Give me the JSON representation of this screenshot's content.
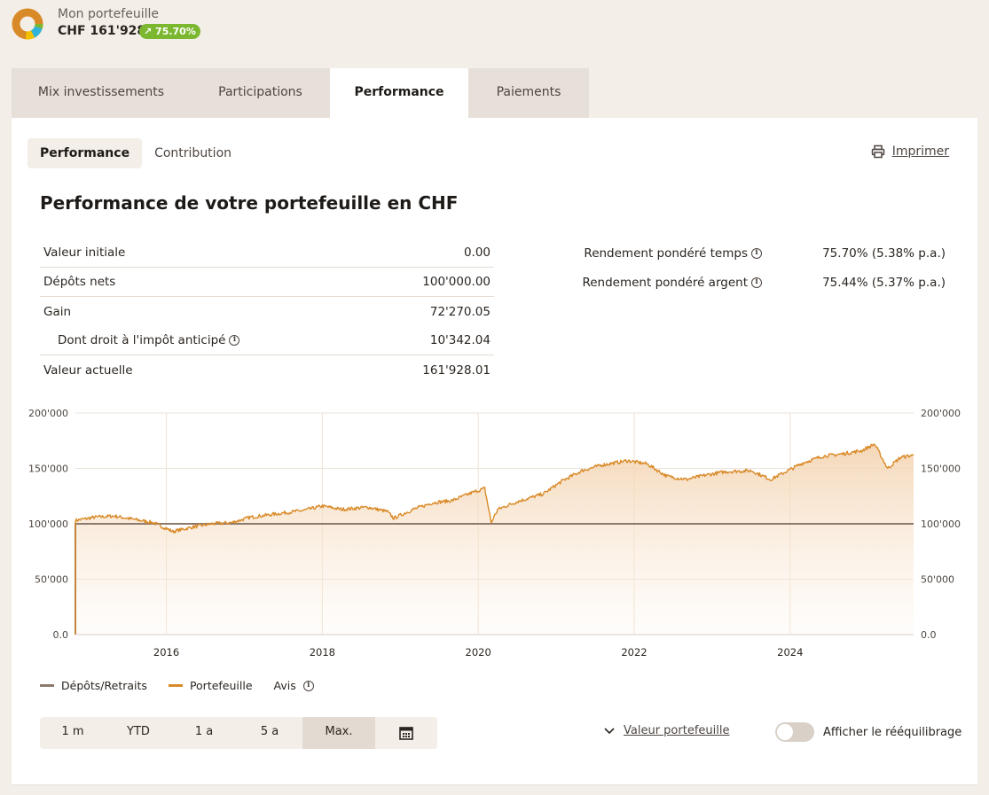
{
  "header": {
    "title": "Mon portefeuille",
    "value": "CHF 161'928",
    "badge": "↗ 75.70%",
    "badge_color": "#7cb82f",
    "donut_colors": [
      "#d98a28",
      "#f2c200",
      "#2fb5d9",
      "#7cb82f"
    ]
  },
  "tabs": [
    {
      "label": "Mix investissements"
    },
    {
      "label": "Participations"
    },
    {
      "label": "Performance"
    },
    {
      "label": "Paiements"
    }
  ],
  "active_tab": "Performance",
  "subtabs": [
    {
      "label": "Performance"
    },
    {
      "label": "Contribution"
    }
  ],
  "print_label": "Imprimer",
  "heading": "Performance de votre portefeuille en CHF",
  "stats": [
    {
      "label": "Valeur initiale",
      "value": "0.00"
    },
    {
      "label": "Dépôts nets",
      "value": "100'000.00"
    },
    {
      "label": "Gain",
      "value": "72'270.05"
    },
    {
      "label": "Dont droit à l'impôt anticipé",
      "value": "10'342.04"
    },
    {
      "label": "Valeur actuelle",
      "value": "161'928.01"
    }
  ],
  "returns": [
    {
      "label": "Rendement pondéré temps",
      "value": "75.70% (5.38% p.a.)"
    },
    {
      "label": "Rendement pondéré argent",
      "value": "75.44% (5.37% p.a.)"
    }
  ],
  "chart_data": {
    "type": "line",
    "x_tick_labels": [
      "2016",
      "2018",
      "2020",
      "2022",
      "2024"
    ],
    "y_tick_labels": [
      "0.0",
      "50'000",
      "100'000",
      "150'000",
      "200'000"
    ],
    "ylim": [
      0,
      200000
    ],
    "xlim": [
      "2014-11",
      "2025-08"
    ],
    "grid": true,
    "colors": {
      "deposits": "#8c7a6e",
      "portfolio": "#d98a28"
    },
    "series": [
      {
        "name": "Dépôts/Retraits",
        "points": [
          [
            "2014-11",
            0
          ],
          [
            "2014-11",
            100000
          ],
          [
            "2025-08",
            100000
          ]
        ]
      },
      {
        "name": "Portefeuille",
        "points": [
          [
            "2014-11",
            0
          ],
          [
            "2014-11",
            103000
          ],
          [
            "2015-02",
            106000
          ],
          [
            "2015-05",
            107000
          ],
          [
            "2015-08",
            104000
          ],
          [
            "2015-11",
            101000
          ],
          [
            "2016-02",
            93000
          ],
          [
            "2016-05",
            97000
          ],
          [
            "2016-08",
            100000
          ],
          [
            "2016-11",
            101000
          ],
          [
            "2017-02",
            106000
          ],
          [
            "2017-06",
            109000
          ],
          [
            "2017-10",
            112000
          ],
          [
            "2018-01",
            116000
          ],
          [
            "2018-04",
            113000
          ],
          [
            "2018-08",
            115000
          ],
          [
            "2018-11",
            111000
          ],
          [
            "2018-12",
            105000
          ],
          [
            "2019-03",
            113000
          ],
          [
            "2019-06",
            119000
          ],
          [
            "2019-09",
            121000
          ],
          [
            "2019-12",
            128000
          ],
          [
            "2020-02",
            132000
          ],
          [
            "2020-03",
            101000
          ],
          [
            "2020-04",
            113000
          ],
          [
            "2020-07",
            120000
          ],
          [
            "2020-11",
            127000
          ],
          [
            "2021-02",
            139000
          ],
          [
            "2021-05",
            148000
          ],
          [
            "2021-08",
            153000
          ],
          [
            "2021-12",
            157000
          ],
          [
            "2022-03",
            154000
          ],
          [
            "2022-06",
            143000
          ],
          [
            "2022-09",
            140000
          ],
          [
            "2022-12",
            144000
          ],
          [
            "2023-03",
            147000
          ],
          [
            "2023-07",
            148000
          ],
          [
            "2023-10",
            140000
          ],
          [
            "2023-12",
            146000
          ],
          [
            "2024-03",
            155000
          ],
          [
            "2024-06",
            161000
          ],
          [
            "2024-09",
            163000
          ],
          [
            "2024-12",
            166000
          ],
          [
            "2025-02",
            172000
          ],
          [
            "2025-04",
            150000
          ],
          [
            "2025-06",
            160000
          ],
          [
            "2025-08",
            161928
          ]
        ]
      }
    ],
    "legend": {
      "notice_label": "Avis"
    }
  },
  "ranges": [
    {
      "label": "1 m"
    },
    {
      "label": "YTD"
    },
    {
      "label": "1 a"
    },
    {
      "label": "5 a"
    },
    {
      "label": "Max."
    }
  ],
  "active_range": "Max.",
  "value_selector": "Valeur portefeuille",
  "rebalance_label": "Afficher le rééquilibrage"
}
